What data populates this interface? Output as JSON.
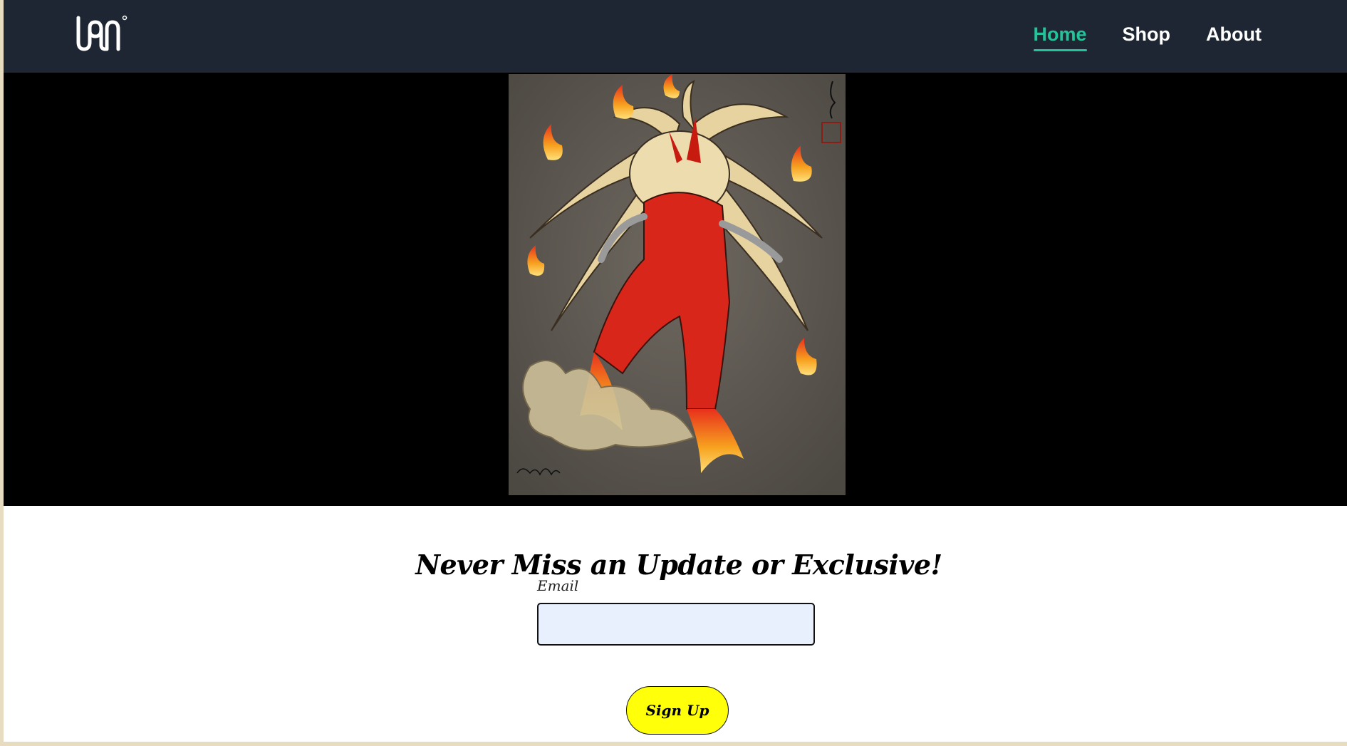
{
  "header": {
    "logo_icon": "logo-wordmark-icon",
    "nav": [
      {
        "label": "Home",
        "active": true
      },
      {
        "label": "Shop",
        "active": false
      },
      {
        "label": "About",
        "active": false
      }
    ],
    "active_color": "#22c59a",
    "background": "#1e2533"
  },
  "hero": {
    "artwork_icon": "fire-yokai-artwork",
    "background": "#000000"
  },
  "signup": {
    "title": "Never Miss an Update or Exclusive!",
    "email_label": "Email",
    "email_value": "",
    "button_label": "Sign Up",
    "button_color": "#ffff0a"
  }
}
